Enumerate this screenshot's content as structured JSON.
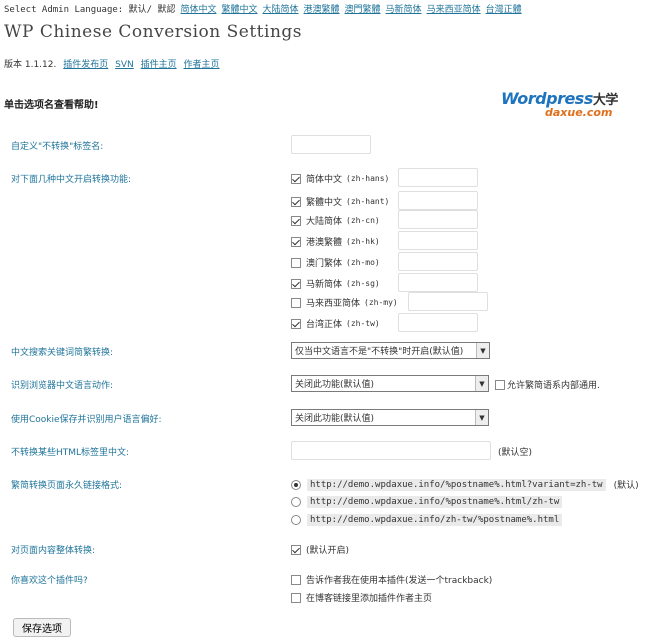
{
  "lang_bar": {
    "prefix": "Select Admin Language: ",
    "current": "默认/ 默認",
    "links": [
      "简体中文",
      "繁體中文",
      "大陆简体",
      "港澳繁體",
      "澳門繁體",
      "马新简体",
      "马来西亚简体",
      "台灣正體"
    ]
  },
  "title": "WP Chinese Conversion Settings",
  "version": {
    "text": "版本 1.1.12.",
    "links": [
      "插件发布页",
      "SVN",
      "插件主页",
      "作者主页"
    ]
  },
  "help_text": "单击选项名查看帮助!",
  "logo": {
    "main": "Wordpress",
    "cn": "大学",
    "sub": "daxue.com"
  },
  "labels": {
    "no_convert_tag": "自定义\"不转换\"标签名:",
    "enable_variants": "对下面几种中文开启转换功能:",
    "search_convert": "中文搜索关键词简繁转换:",
    "browser_detect": "识别浏览器中文语言动作:",
    "cookie_detect": "使用Cookie保存并识别用户语言偏好:",
    "no_convert_html": "不转换某些HTML标签里中文:",
    "permalink_format": "繁简转换页面永久链接格式:",
    "full_page": "对页面内容整体转换:",
    "like_plugin": "你喜欢这个插件吗?"
  },
  "variants": [
    {
      "label": "简体中文",
      "code": "(zh-hans)",
      "checked": true
    },
    {
      "label": "繁體中文",
      "code": "(zh-hant)",
      "checked": true
    },
    {
      "label": "大陆简体",
      "code": "(zh-cn)",
      "checked": true
    },
    {
      "label": "港澳繁體",
      "code": "(zh-hk)",
      "checked": true
    },
    {
      "label": "澳门繁体",
      "code": "(zh-mo)",
      "checked": false
    },
    {
      "label": "马新简体",
      "code": "(zh-sg)",
      "checked": true
    },
    {
      "label": "马来西亚简体",
      "code": "(zh-my)",
      "checked": false
    },
    {
      "label": "台湾正体",
      "code": "(zh-tw)",
      "checked": true
    }
  ],
  "search_select": "仅当中文语言不是\"不转换\"时开启(默认值)",
  "browser_select": "关闭此功能(默认值)",
  "browser_note": "允许繁简语系内部通用.",
  "cookie_select": "关闭此功能(默认值)",
  "html_default_note": "(默认空)",
  "permalinks": [
    {
      "url": "http://demo.wpdaxue.info/%postname%.html?variant=zh-tw",
      "note": "(默认)",
      "checked": true
    },
    {
      "url": "http://demo.wpdaxue.info/%postname%.html/zh-tw",
      "note": "",
      "checked": false
    },
    {
      "url": "http://demo.wpdaxue.info/zh-tw/%postname%.html",
      "note": "",
      "checked": false
    }
  ],
  "full_page_note": "(默认开启)",
  "like_options": [
    {
      "label": "告诉作者我在使用本插件(发送一个trackback)",
      "checked": false
    },
    {
      "label": "在博客链接里添加插件作者主页",
      "checked": false
    }
  ],
  "save_button": "保存选项",
  "colors": {
    "link": "#21759b",
    "logo_blue": "#1e73be",
    "logo_orange": "#e06e1b"
  }
}
